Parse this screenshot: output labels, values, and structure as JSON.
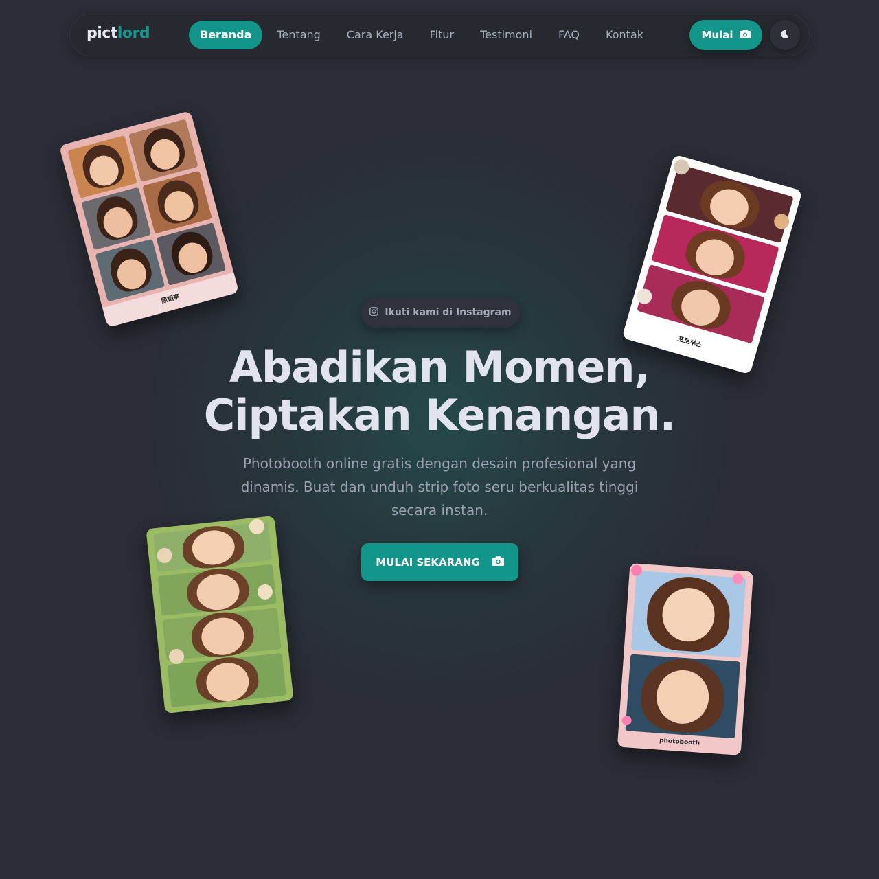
{
  "brand": {
    "logo_part1": "pict",
    "logo_part2": "lord"
  },
  "nav": {
    "items": [
      {
        "label": "Beranda",
        "active": true
      },
      {
        "label": "Tentang",
        "active": false
      },
      {
        "label": "Cara Kerja",
        "active": false
      },
      {
        "label": "Fitur",
        "active": false
      },
      {
        "label": "Testimoni",
        "active": false
      },
      {
        "label": "FAQ",
        "active": false
      },
      {
        "label": "Kontak",
        "active": false
      }
    ],
    "start_label": "Mulai",
    "start_icon": "camera-icon",
    "theme_icon": "moon-icon"
  },
  "hero": {
    "instagram_badge": "Ikuti kami di Instagram",
    "instagram_icon": "instagram-icon",
    "title_line1": "Abadikan Momen,",
    "title_line2": "Ciptakan Kenangan.",
    "subtitle": "Photobooth online gratis dengan desain profesional yang dinamis. Buat dan unduh strip foto seru berkualitas tinggi secara instan.",
    "cta_label": "MULAI SEKARANG",
    "cta_icon": "camera-icon"
  },
  "strips": {
    "top_left_label": "照相亭",
    "top_right_label": "포토부스",
    "bottom_right_label": "photobooth"
  },
  "colors": {
    "accent": "#12968a",
    "background": "#2a2d36",
    "nav_bg": "#262930",
    "text_primary": "#e1e4ee",
    "text_muted": "#9ba1b1"
  }
}
